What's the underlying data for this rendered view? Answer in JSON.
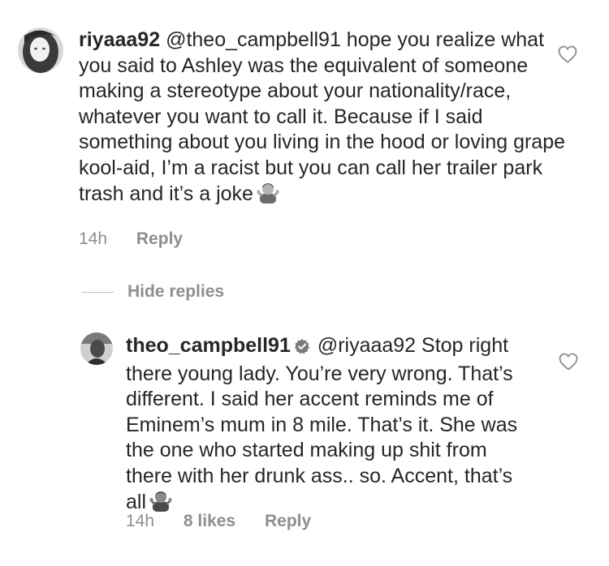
{
  "comments": [
    {
      "username": "riyaaa92",
      "text": "@theo_campbell91 hope you realize what you said to Ashley was the equivalent of someone making a stereotype about your nationality/race, whatever you want to call it. Because if I said something about you living in the hood or loving grape kool-aid, I’m a racist but you can call her trailer park trash and it’s a joke",
      "emoji": "woman-shrugging-icon",
      "time": "14h",
      "reply_label": "Reply",
      "verified": false
    },
    {
      "username": "theo_campbell91",
      "text": "@riyaaa92 Stop right there young lady. You’re very wrong. That’s different. I said her accent reminds me of Eminem’s mum in 8 mile. That’s it. She was the one who started making up shit from there with her drunk ass.. so. Accent, that’s all",
      "emoji": "man-shrugging-icon",
      "time": "14h",
      "likes": "8 likes",
      "reply_label": "Reply",
      "verified": true
    }
  ],
  "thread": {
    "hide_replies_label": "Hide replies"
  },
  "colors": {
    "text": "#262626",
    "secondary": "#8e8e8e",
    "divider": "#bdbdbd"
  }
}
